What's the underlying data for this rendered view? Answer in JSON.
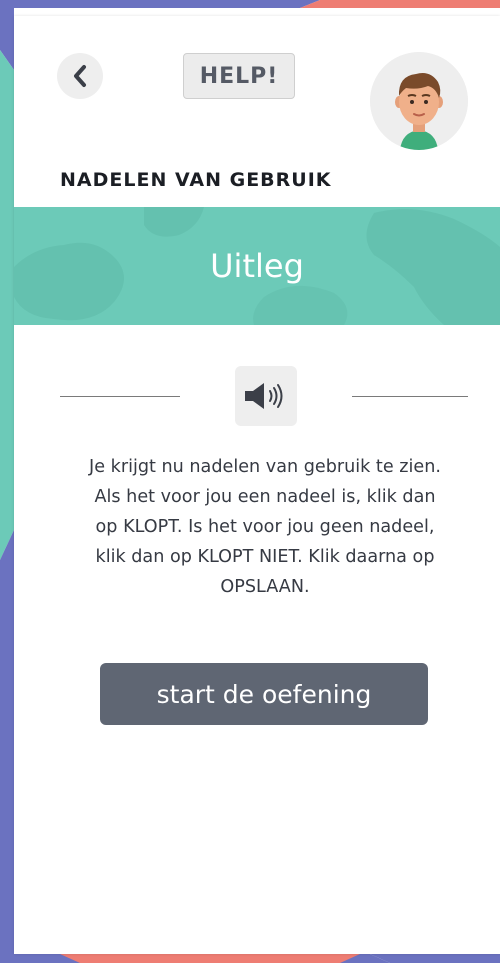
{
  "header": {
    "back_icon": "chevron-left-icon",
    "help_label": "HELP!",
    "avatar_icon": "boy-avatar"
  },
  "section": {
    "title": "NADELEN VAN GEBRUIK"
  },
  "banner": {
    "title": "Uitleg"
  },
  "audio": {
    "icon": "speaker-icon"
  },
  "instructions": {
    "lines": [
      "Je krijgt nu nadelen van gebruik te zien.",
      "Als het voor jou een nadeel is, klik dan",
      "op KLOPT. Is het voor jou geen nadeel,",
      "klik dan op KLOPT NIET. Klik daarna op",
      "OPSLAAN."
    ]
  },
  "start": {
    "label": "start de oefening"
  },
  "colors": {
    "teal": "#6ccab8",
    "coral": "#ee7d73",
    "indigo": "#6b72c0",
    "button_dark": "#5f6673",
    "text_dark": "#1b1e24"
  }
}
